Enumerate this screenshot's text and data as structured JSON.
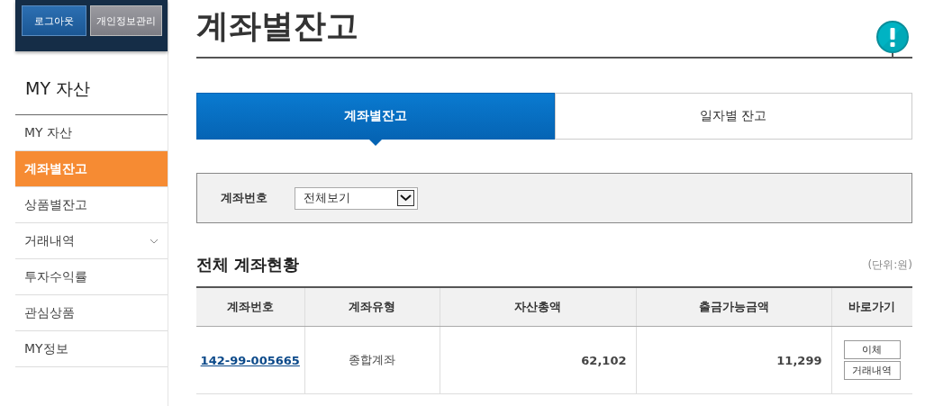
{
  "header_buttons": [
    {
      "label": "로그아웃",
      "kind": "primary"
    },
    {
      "label": "개인정보관리",
      "kind": "secondary"
    }
  ],
  "sidebar": {
    "title": "MY 자산",
    "items": [
      {
        "label": "MY 자산",
        "selected": false,
        "has_submenu": false
      },
      {
        "label": "계좌별잔고",
        "selected": true,
        "has_submenu": false
      },
      {
        "label": "상품별잔고",
        "selected": false,
        "has_submenu": false
      },
      {
        "label": "거래내역",
        "selected": false,
        "has_submenu": true
      },
      {
        "label": "투자수익률",
        "selected": false,
        "has_submenu": false
      },
      {
        "label": "관심상품",
        "selected": false,
        "has_submenu": false
      },
      {
        "label": "MY정보",
        "selected": false,
        "has_submenu": false
      }
    ]
  },
  "page_title": "계좌별잔고",
  "tabs": [
    {
      "label": "계좌별잔고",
      "selected": true
    },
    {
      "label": "일자별 잔고",
      "selected": false
    }
  ],
  "filter": {
    "label": "계좌번호",
    "select_value": "전체보기"
  },
  "section": {
    "title": "전체 계좌현황",
    "unit": "(단위:원)"
  },
  "table": {
    "columns": [
      "계좌번호",
      "계좌유형",
      "자산총액",
      "출금가능금액",
      "바로가기"
    ],
    "rows": [
      {
        "account": "142-99-005665",
        "type": "종합계좌",
        "total": "62,102",
        "available": "11,299",
        "actions": [
          "이체",
          "거래내역"
        ]
      }
    ]
  }
}
